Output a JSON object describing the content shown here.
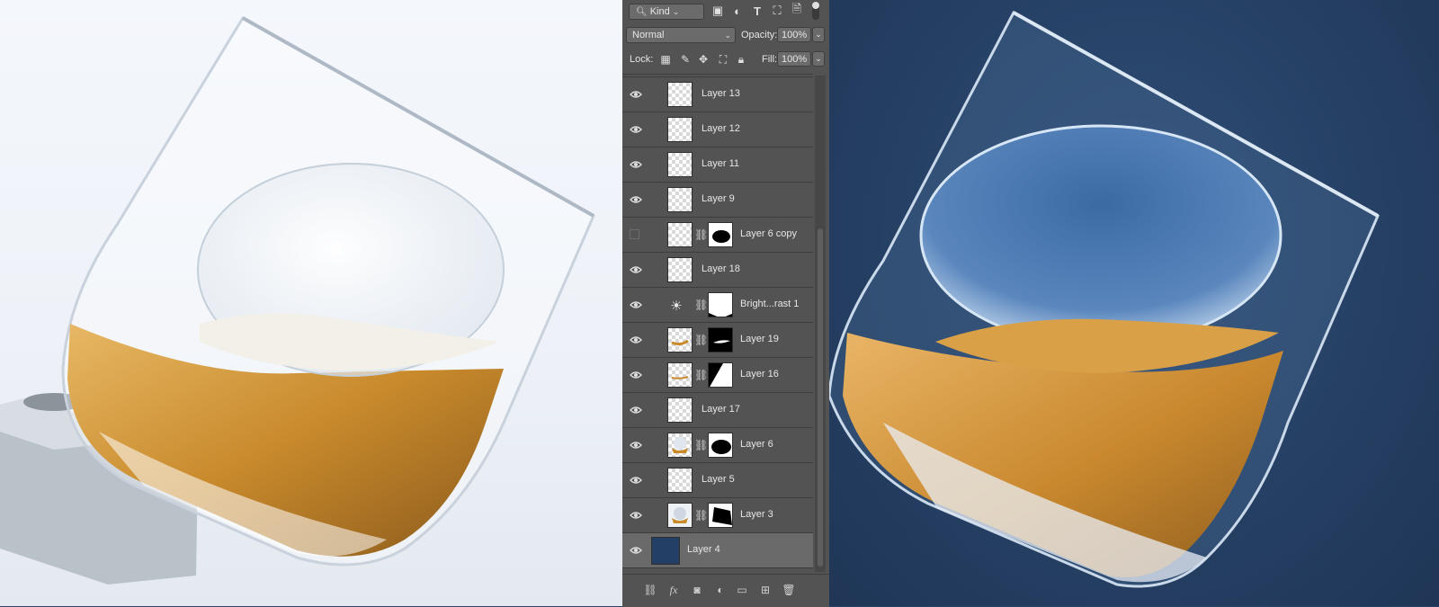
{
  "filter": {
    "kind_label": "Kind"
  },
  "blend": {
    "mode": "Normal",
    "opacity_label": "Opacity:",
    "opacity_value": "100%"
  },
  "lock": {
    "label": "Lock:",
    "fill_label": "Fill:",
    "fill_value": "100%"
  },
  "layers": [
    {
      "name": "Layer 13",
      "visible": true
    },
    {
      "name": "Layer 12",
      "visible": true
    },
    {
      "name": "Layer 11",
      "visible": true
    },
    {
      "name": "Layer 9",
      "visible": true
    },
    {
      "name": "Layer 6 copy",
      "visible": false,
      "has_mask": true
    },
    {
      "name": "Layer 18",
      "visible": true
    },
    {
      "name": "Bright...rast 1",
      "visible": true,
      "adjustment": true,
      "has_mask": true
    },
    {
      "name": "Layer 19",
      "visible": true,
      "has_mask": true
    },
    {
      "name": "Layer 16",
      "visible": true,
      "has_mask": true
    },
    {
      "name": "Layer 17",
      "visible": true
    },
    {
      "name": "Layer 6",
      "visible": true,
      "has_mask": true
    },
    {
      "name": "Layer 5",
      "visible": true
    },
    {
      "name": "Layer 3",
      "visible": true,
      "has_mask": true
    },
    {
      "name": "Layer 4",
      "visible": true,
      "selected": true,
      "fill_color": "#233f66"
    }
  ],
  "icons": {
    "filter": [
      "image-filter-icon",
      "adjustment-filter-icon",
      "type-filter-icon",
      "shape-filter-icon",
      "smart-object-filter-icon"
    ],
    "lock": [
      "lock-transparent-icon",
      "lock-paint-icon",
      "lock-move-icon",
      "lock-artboard-icon",
      "lock-all-icon"
    ],
    "bottom": [
      "link-layers-icon",
      "fx-icon",
      "add-mask-icon",
      "new-adjustment-icon",
      "new-group-icon",
      "new-layer-icon",
      "delete-layer-icon"
    ]
  },
  "colors": {
    "panel": "#535353",
    "background_fill": "#233f66"
  }
}
